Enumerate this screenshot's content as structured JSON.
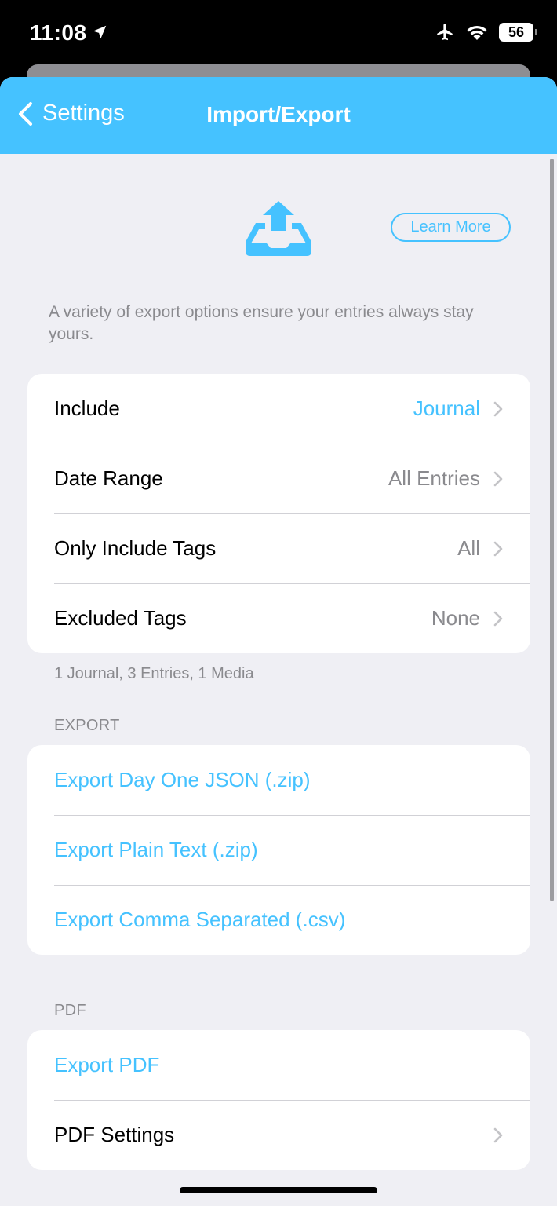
{
  "status_bar": {
    "time": "11:08",
    "battery": "56",
    "icons": [
      "location-arrow-icon",
      "airplane-icon",
      "wifi-icon",
      "battery-icon"
    ]
  },
  "nav": {
    "back_label": "Settings",
    "title": "Import/Export"
  },
  "hero": {
    "icon": "export-tray-icon",
    "learn_more_label": "Learn More",
    "description": "A variety of export options ensure your entries always stay yours."
  },
  "filters": {
    "rows": [
      {
        "label": "Include",
        "value": "Journal"
      },
      {
        "label": "Date Range",
        "value": "All Entries"
      },
      {
        "label": "Only Include Tags",
        "value": "All"
      },
      {
        "label": "Excluded Tags",
        "value": "None"
      }
    ],
    "footnote": "1 Journal, 3 Entries, 1 Media"
  },
  "export": {
    "header": "EXPORT",
    "actions": [
      {
        "label": "Export Day One JSON (.zip)"
      },
      {
        "label": "Export Plain Text (.zip)"
      },
      {
        "label": "Export Comma Separated (.csv)"
      }
    ]
  },
  "pdf": {
    "header": "PDF",
    "export_label": "Export PDF",
    "settings_label": "PDF Settings"
  },
  "colors": {
    "accent": "#45c2ff",
    "background": "#efeff4",
    "secondary_text": "#8a8a8e"
  }
}
